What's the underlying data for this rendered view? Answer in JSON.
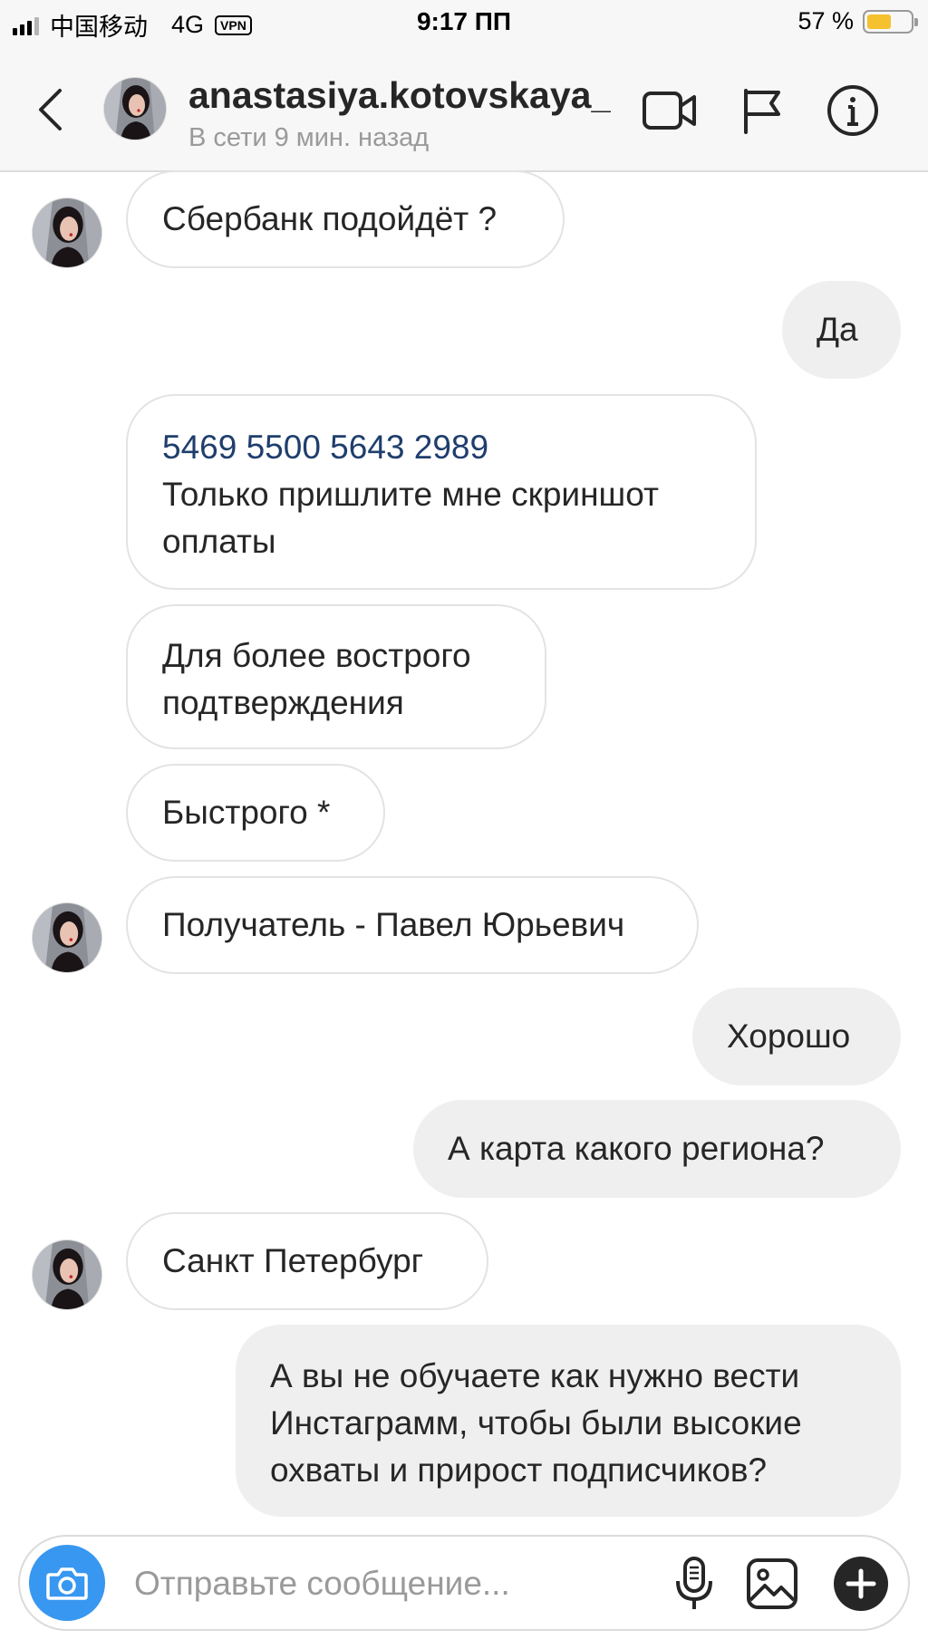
{
  "status_bar": {
    "carrier": "中国移动",
    "network": "4G",
    "vpn": "VPN",
    "time": "9:17 ПП",
    "battery_percent": "57 %",
    "battery_level": 0.57
  },
  "header": {
    "username": "anastasiya.kotovskaya_",
    "presence": "В сети 9 мин. назад",
    "back_icon": "chevron-left-icon",
    "video_icon": "video-camera-icon",
    "flag_icon": "flag-icon",
    "info_icon": "info-icon"
  },
  "messages": [
    {
      "direction": "in",
      "text": "Сбербанк подойдёт ?"
    },
    {
      "direction": "out",
      "text": "Да"
    },
    {
      "direction": "in",
      "lines": [
        "5469 5500 5643 2989",
        "Только пришлите мне скриншот",
        "оплаты"
      ]
    },
    {
      "direction": "in",
      "lines": [
        "Для более вострого",
        "подтверждения"
      ]
    },
    {
      "direction": "in",
      "text": "Быстрого *"
    },
    {
      "direction": "in",
      "text": "Получатель - Павел Юрьевич"
    },
    {
      "direction": "out",
      "text": "Хорошо"
    },
    {
      "direction": "out",
      "text": "А карта какого региона?"
    },
    {
      "direction": "in",
      "text": "Санкт Петербург"
    },
    {
      "direction": "out",
      "lines": [
        "А вы не обучаете как нужно вести",
        "Инстаграмм, чтобы были высокие",
        "охваты и прирост подписчиков?"
      ]
    }
  ],
  "composer": {
    "placeholder": "Отправьте сообщение...",
    "camera_icon": "camera-icon",
    "mic_icon": "microphone-icon",
    "gallery_icon": "image-gallery-icon",
    "plus_icon": "plus-icon"
  },
  "colors": {
    "accent": "#3897f0",
    "link": "#1f3e6d",
    "battery": "#f5c12e",
    "outgoing_bubble": "#efefef"
  }
}
